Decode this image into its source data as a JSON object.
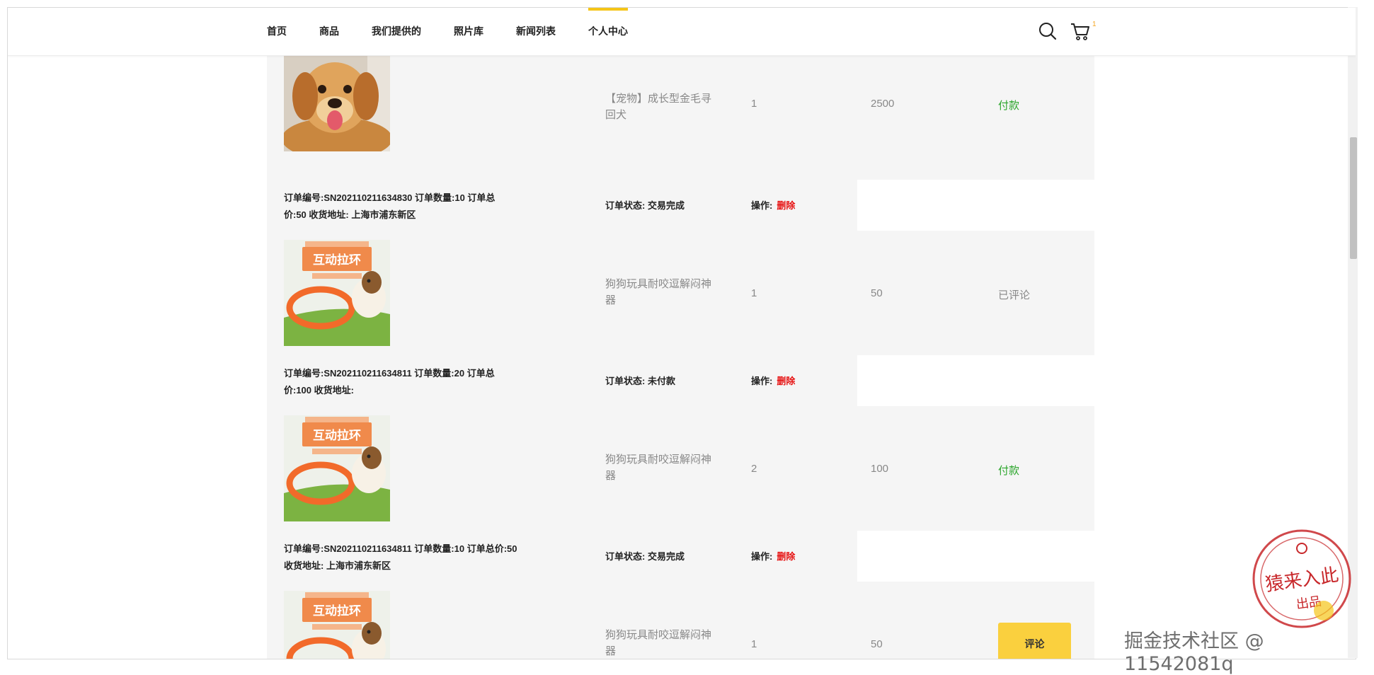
{
  "nav": {
    "items": [
      "首页",
      "商品",
      "我们提供的",
      "照片库",
      "新闻列表",
      "个人中心"
    ],
    "active_index": 5
  },
  "header_icons": [
    "search-icon",
    "cart-icon"
  ],
  "cart_count": "1",
  "items": [
    {
      "name": "【宠物】成长型金毛寻回犬",
      "qty": "1",
      "price": "2500",
      "action": "付款",
      "action_type": "pay",
      "image": "golden-retriever-puppy"
    },
    {
      "name": "狗狗玩具耐咬逗解闷神器",
      "qty": "1",
      "price": "50",
      "action": "已评论",
      "action_type": "done",
      "image": "dog-toy-ring"
    },
    {
      "name": "狗狗玩具耐咬逗解闷神器",
      "qty": "2",
      "price": "100",
      "action": "付款",
      "action_type": "pay",
      "image": "dog-toy-ring"
    },
    {
      "name": "狗狗玩具耐咬逗解闷神器",
      "qty": "1",
      "price": "50",
      "action": "评论",
      "action_type": "review",
      "image": "dog-toy-ring"
    }
  ],
  "orders": [
    {
      "info_line1": "订单编号:SN202110211634830 订单数量:10 订单总",
      "info_line2": "价:50 收货地址: 上海市浦东新区",
      "status": "订单状态: 交易完成",
      "op_label": "操作:",
      "delete": "删除"
    },
    {
      "info_line1": "订单编号:SN202110211634811 订单数量:20 订单总",
      "info_line2": "价:100 收货地址:",
      "status": "订单状态: 未付款",
      "op_label": "操作:",
      "delete": "删除"
    },
    {
      "info_line1": "订单编号:SN202110211634811 订单数量:10 订单总价:50",
      "info_line2": "收货地址: 上海市浦东新区",
      "status": "订单状态: 交易完成",
      "op_label": "操作:",
      "delete": "删除"
    }
  ],
  "toy_banner": "互动拉环",
  "watermark": "掘金技术社区 @ 11542081q",
  "stamp": "猿来入此 出品",
  "colors": {
    "accent": "#f5c518",
    "pay_green": "#2aa52a",
    "delete_red": "#e61010",
    "review_btn": "#fad03e"
  }
}
